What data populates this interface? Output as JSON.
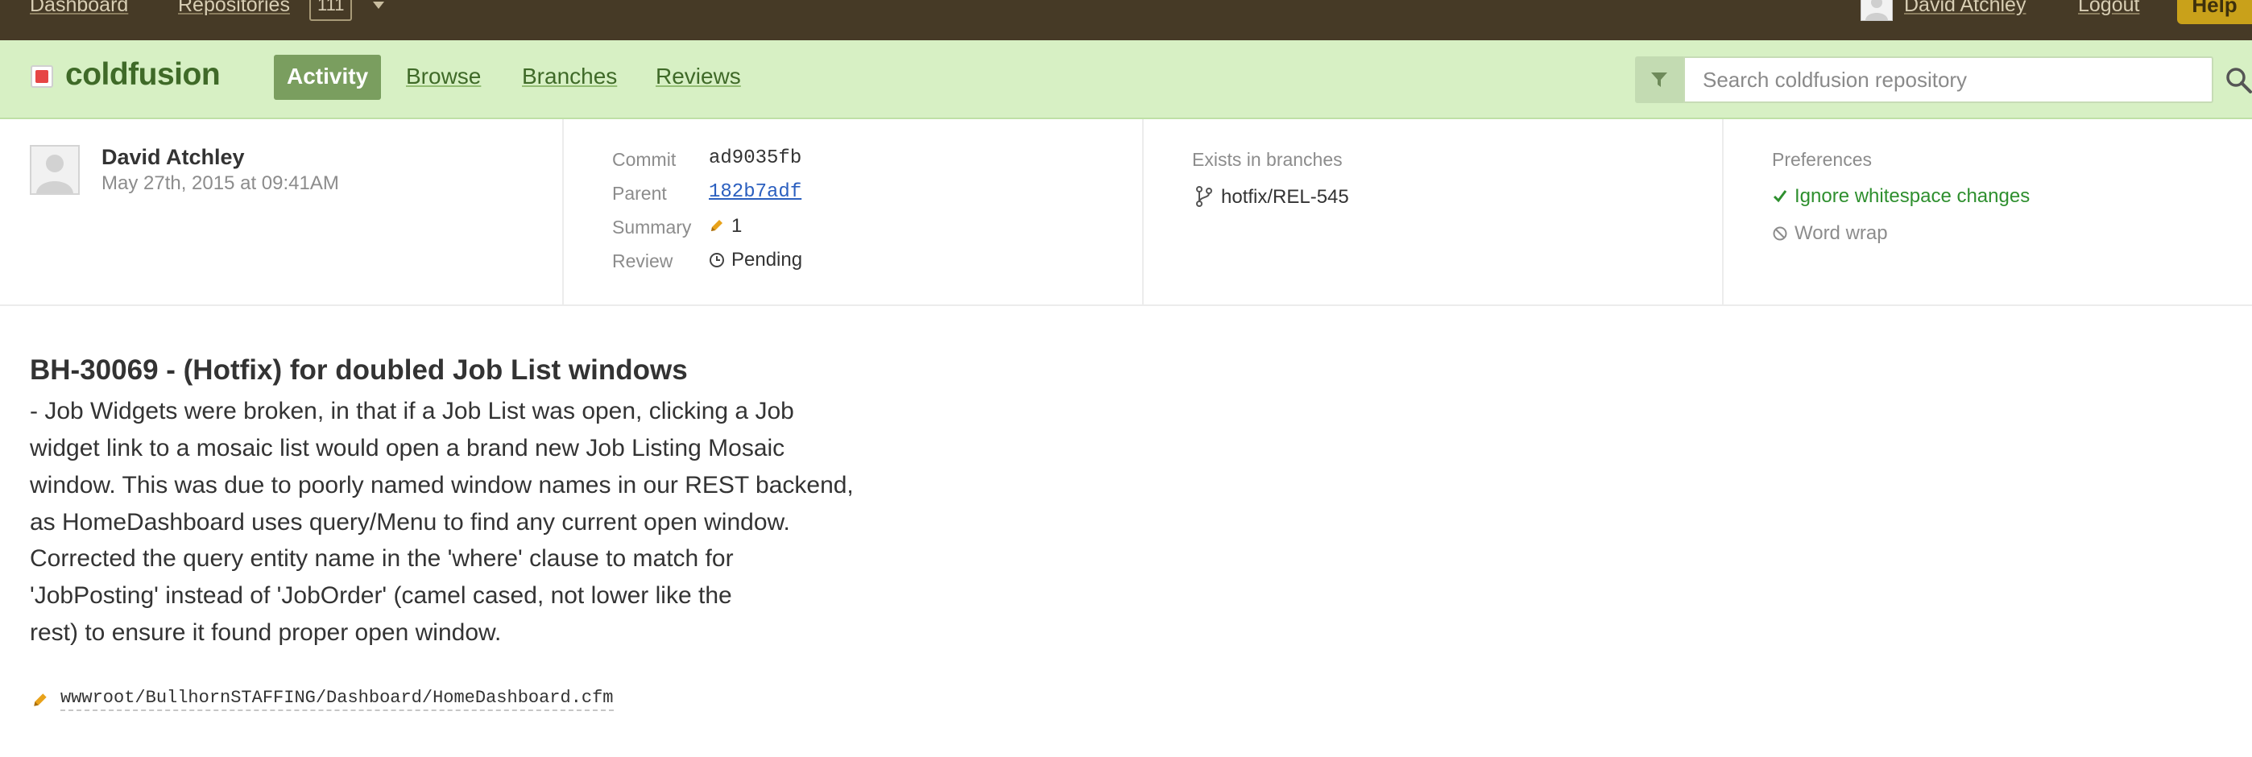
{
  "topnav": {
    "dashboard": "Dashboard",
    "repositories": "Repositories",
    "repo_count": "111",
    "user": "David Atchley",
    "logout": "Logout",
    "help": "Help"
  },
  "repo": {
    "name": "coldfusion",
    "tabs": [
      "Activity",
      "Browse",
      "Branches",
      "Reviews"
    ],
    "active_tab": "Activity",
    "search_placeholder": "Search coldfusion repository"
  },
  "commit": {
    "author": "David Atchley",
    "date": "May 27th, 2015 at 09:41AM",
    "labels": {
      "commit": "Commit",
      "parent": "Parent",
      "summary": "Summary",
      "review": "Review"
    },
    "hash": "ad9035fb",
    "parent": "182b7adf",
    "summary_count": "1",
    "review_status": "Pending"
  },
  "branches": {
    "title": "Exists in branches",
    "items": [
      "hotfix/REL-545"
    ]
  },
  "preferences": {
    "title": "Preferences",
    "ignore_whitespace": "Ignore whitespace changes",
    "word_wrap": "Word wrap"
  },
  "message": {
    "title": "BH-30069 - (Hotfix) for doubled Job List windows",
    "lines": [
      "- Job Widgets were broken, in that if a Job List was open, clicking a Job",
      "widget link to a mosaic list would open a brand new Job Listing Mosaic",
      "window. This was due to poorly named window names in our REST backend,",
      "as HomeDashboard uses query/Menu to find any current open window.",
      "Corrected the query entity name in the 'where' clause to match for",
      "'JobPosting' instead of 'JobOrder' (camel cased, not lower like the",
      "rest) to ensure it found proper open window."
    ]
  },
  "files": [
    "wwwroot/BullhornSTAFFING/Dashboard/HomeDashboard.cfm"
  ],
  "colors": {
    "topbar": "#463a26",
    "repobar": "#d7f0c4",
    "accent_green": "#3f6a28",
    "active_tab": "#7a9e5f",
    "help": "#c9a11a",
    "link_blue": "#2b5fbf",
    "pref_on": "#2e8f2e"
  }
}
